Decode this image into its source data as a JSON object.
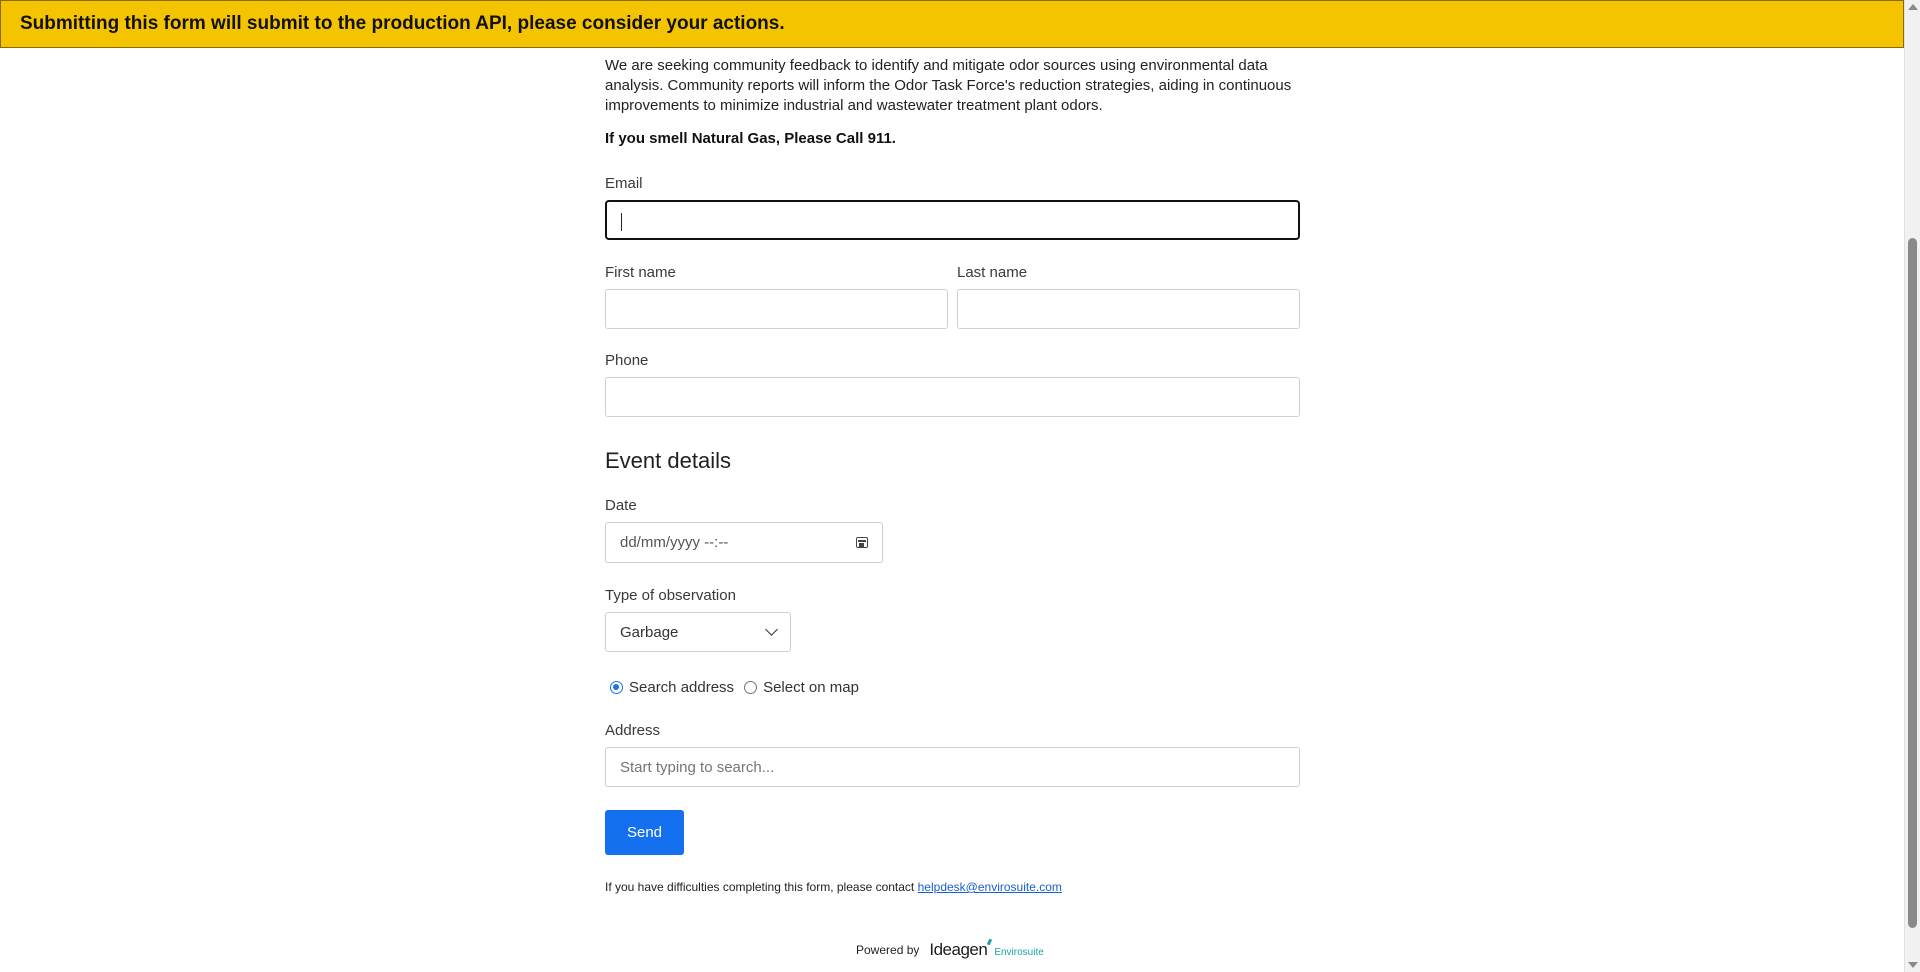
{
  "banner": {
    "text": "Submitting this form will submit to the production API, please consider your actions."
  },
  "intro": {
    "paragraph": "We are seeking community feedback to identify and mitigate odor sources using environmental data analysis. Community reports will inform the Odor Task Force's reduction strategies, aiding in continuous improvements to minimize industrial and wastewater treatment plant odors.",
    "warning": "If you smell Natural Gas, Please Call 911."
  },
  "contact": {
    "email_label": "Email",
    "email_value": "",
    "first_name_label": "First name",
    "first_name_value": "",
    "last_name_label": "Last name",
    "last_name_value": "",
    "phone_label": "Phone",
    "phone_value": ""
  },
  "event": {
    "title": "Event details",
    "date_label": "Date",
    "date_placeholder": "dd/mm/yyyy --:--",
    "observation_label": "Type of observation",
    "observation_selected": "Garbage",
    "location_modes": [
      {
        "label": "Search address",
        "checked": true
      },
      {
        "label": "Select on map",
        "checked": false
      }
    ],
    "address_label": "Address",
    "address_placeholder": "Start typing to search..."
  },
  "actions": {
    "send_label": "Send"
  },
  "help": {
    "text": "If you have difficulties completing this form, please contact",
    "email_link": "helpdesk@envirosuite.com"
  },
  "footer": {
    "powered_by": "Powered by",
    "logo_primary": "Ideagen",
    "logo_secondary": "Envirosuite"
  },
  "colors": {
    "banner_bg": "#f5c400",
    "primary_button": "#1570ef",
    "link": "#1a5fd0",
    "logo_accent": "#1aa1a8"
  }
}
